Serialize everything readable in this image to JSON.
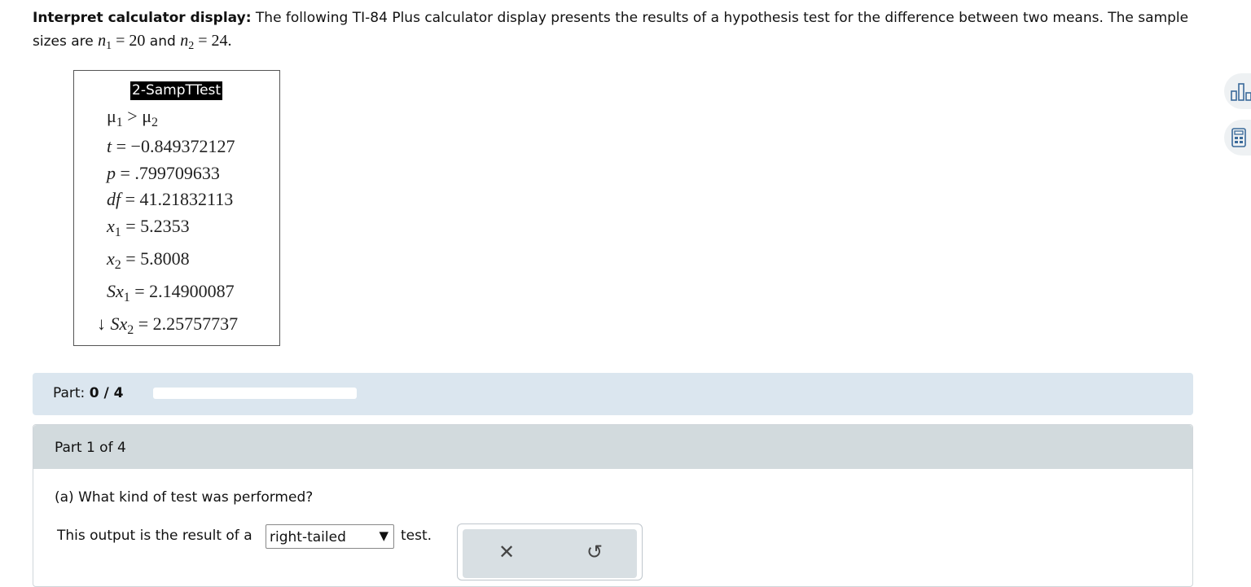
{
  "intro": {
    "heading": "Interpret calculator display:",
    "text1": " The following TI-84 Plus calculator display presents the results of a hypothesis test for the difference between two means. The sample sizes are ",
    "n1_var": "n",
    "n1_sub": "1",
    "n1_val": " = 20",
    "and": " and ",
    "n2_var": "n",
    "n2_sub": "2",
    "n2_val": " = 24."
  },
  "calculator": {
    "title": "2-SampTTest",
    "hyp_mu1": "μ",
    "hyp_sub1": "1",
    "hyp_gt": " > μ",
    "hyp_sub2": "2",
    "t_var": "t",
    "t_val": " = −0.849372127",
    "p_var": "p",
    "p_val": " = .799709633",
    "df_var": "df",
    "df_val": " = 41.21832113",
    "x1_var": "x",
    "x1_sub": "1",
    "x1_val": " = 5.2353",
    "x2_var": "x",
    "x2_sub": "2",
    "x2_val": " = 5.8008",
    "sx1_var": "Sx",
    "sx1_sub": "1",
    "sx1_val": " = 2.14900087",
    "arrow": "↓ ",
    "sx2_var": "Sx",
    "sx2_sub": "2",
    "sx2_val": " = 2.25757737"
  },
  "progress": {
    "label": "Part: ",
    "value_text": "0 / 4",
    "fraction": 0
  },
  "part": {
    "header": "Part 1 of 4",
    "question": "(a) What kind of test was performed?",
    "answer_prefix": "This output is the result of a",
    "select_value": "right-tailed",
    "answer_suffix": "test."
  },
  "icons": {
    "dropdown": "▼",
    "clear": "✕",
    "undo": "↺"
  }
}
